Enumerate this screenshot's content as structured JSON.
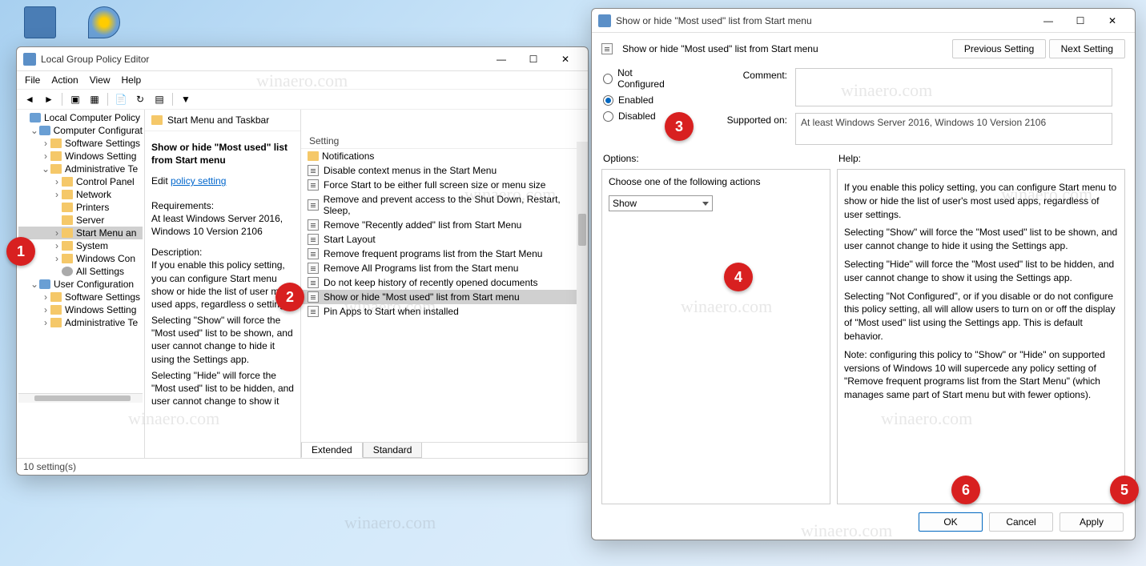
{
  "gpedit": {
    "title": "Local Group Policy Editor",
    "menu": [
      "File",
      "Action",
      "View",
      "Help"
    ],
    "tree": {
      "root": "Local Computer Policy",
      "comp_cfg": "Computer Configurat",
      "soft": "Software Settings",
      "win": "Windows Setting",
      "admin": "Administrative Te",
      "ctrl": "Control Panel",
      "net": "Network",
      "printers": "Printers",
      "server": "Server",
      "startmenu": "Start Menu an",
      "system": "System",
      "wincomp": "Windows Con",
      "allset": "All Settings",
      "user_cfg": "User Configuration",
      "soft2": "Software Settings",
      "win2": "Windows Setting",
      "admin2": "Administrative Te"
    },
    "mid": {
      "header": "Start Menu and Taskbar",
      "policy_title": "Show or hide \"Most used\" list from Start menu",
      "edit_prefix": "Edit ",
      "edit_link": "policy setting",
      "req_label": "Requirements:",
      "req_text": "At least Windows Server 2016, Windows 10 Version 2106",
      "desc_label": "Description:",
      "desc_p1": "If you enable this policy setting, you can configure Start menu show or hide the list of user most used apps, regardless o settings.",
      "desc_p2": "Selecting \"Show\" will force the \"Most used\" list to be shown, and user cannot change to hide it using the Settings app.",
      "desc_p3": "Selecting \"Hide\" will force the \"Most used\" list to be hidden, and user cannot change to show it"
    },
    "list": {
      "col": "Setting",
      "items": [
        "Notifications",
        "Disable context menus in the Start Menu",
        "Force Start to be either full screen size or menu size",
        "Remove and prevent access to the Shut Down, Restart, Sleep,",
        "Remove \"Recently added\" list from Start Menu",
        "Start Layout",
        "Remove frequent programs list from the Start Menu",
        "Remove All Programs list from the Start menu",
        "Do not keep history of recently opened documents",
        "Show or hide \"Most used\" list from Start menu",
        "Pin Apps to Start when installed"
      ]
    },
    "tabs": {
      "extended": "Extended",
      "standard": "Standard"
    },
    "status": "10 setting(s)"
  },
  "dlg": {
    "title": "Show or hide \"Most used\" list from Start menu",
    "heading": "Show or hide \"Most used\" list from Start menu",
    "prev": "Previous Setting",
    "next": "Next Setting",
    "not_conf": "Not Configured",
    "enabled": "Enabled",
    "disabled": "Disabled",
    "comment": "Comment:",
    "supported": "Supported on:",
    "supported_text": "At least Windows Server 2016, Windows 10 Version 2106",
    "options": "Options:",
    "help": "Help:",
    "opt_label": "Choose one of the following actions",
    "opt_value": "Show",
    "help_p1": "If you enable this policy setting, you can configure Start menu to show or hide the list of user's most used apps, regardless of user settings.",
    "help_p2": "Selecting \"Show\" will force the \"Most used\" list to be shown, and user cannot change to hide it using the Settings app.",
    "help_p3": "Selecting \"Hide\" will force the \"Most used\" list to be hidden, and user cannot change to show it using the Settings app.",
    "help_p4": "Selecting \"Not Configured\", or if you disable or do not configure this policy setting, all will allow users to turn on or off the display of \"Most used\" list using the Settings app. This is default behavior.",
    "help_p5": "Note: configuring this policy to \"Show\" or \"Hide\" on supported versions of Windows 10 will supercede any policy setting of \"Remove frequent programs list from the Start Menu\" (which manages same part of Start menu but with fewer options).",
    "ok": "OK",
    "cancel": "Cancel",
    "apply": "Apply"
  },
  "callouts": {
    "c1": "1",
    "c2": "2",
    "c3": "3",
    "c4": "4",
    "c5": "5",
    "c6": "6"
  },
  "watermark": "winaero.com"
}
